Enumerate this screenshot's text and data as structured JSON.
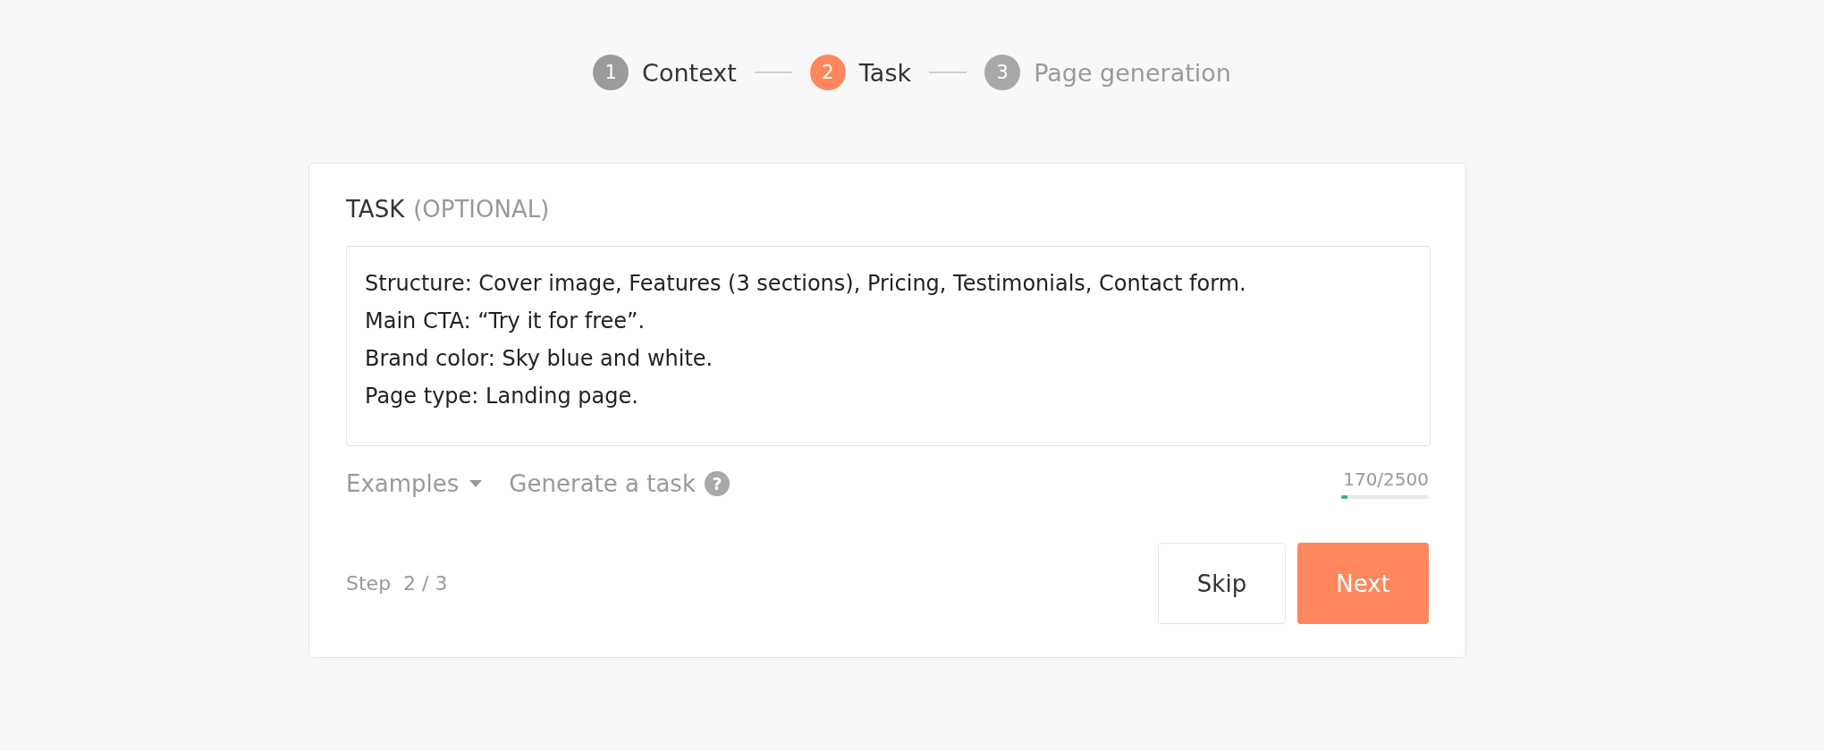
{
  "steps": [
    {
      "number": "1",
      "label": "Context",
      "completed": true,
      "selected": false
    },
    {
      "number": "2",
      "label": "Task",
      "completed": false,
      "selected": true
    },
    {
      "number": "3",
      "label": "Page generation",
      "completed": false,
      "selected": false
    }
  ],
  "card": {
    "title": "TASK",
    "title_note": "(OPTIONAL)",
    "task_field": {
      "value": "Structure: Cover image, Features (3 sections), Pricing, Testimonials, Contact form.\nMain CTA: “Try it for free”.\nBrand color: Sky blue and white.\nPage type: Landing page."
    },
    "examples_label": "Examples",
    "generate_label": "Generate a task",
    "help_glyph": "?",
    "counter": {
      "text": "170/2500",
      "level": 0.068
    },
    "step_text": "Step  2 / 3",
    "buttons": [
      {
        "label": "Skip",
        "kind": "secondary"
      },
      {
        "label": "Next",
        "kind": "primary"
      }
    ]
  }
}
